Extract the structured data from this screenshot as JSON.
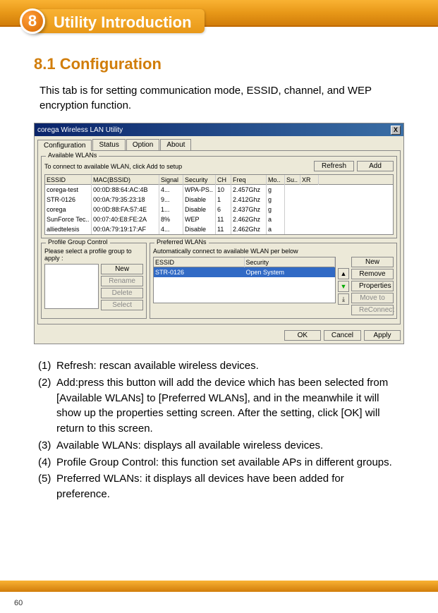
{
  "chapter": {
    "number": "8",
    "title": "Utility Introduction"
  },
  "section": {
    "heading": "8.1 Configuration"
  },
  "intro": "This tab is for setting communication mode, ESSID, channel, and WEP encryption function.",
  "dialog": {
    "title": "corega Wireless LAN Utility",
    "tabs": [
      "Configuration",
      "Status",
      "Option",
      "About"
    ],
    "available_group": "Available WLANs",
    "available_note": "To connect to available WLAN, click Add to setup",
    "btn_refresh": "Refresh",
    "btn_add": "Add",
    "columns": [
      "ESSID",
      "MAC(BSSID)",
      "Signal",
      "Security",
      "CH",
      "Freq",
      "Mo..",
      "Su..",
      "XR"
    ],
    "rows": [
      {
        "essid": "corega-test",
        "mac": "00:0D:88:64:AC:4B",
        "signal": "4...",
        "security": "WPA-PS..",
        "ch": "10",
        "freq": "2.457Ghz",
        "mo": "g",
        "su": "",
        "xr": ""
      },
      {
        "essid": "STR-0126",
        "mac": "00:0A:79:35:23:18",
        "signal": "9...",
        "security": "Disable",
        "ch": "1",
        "freq": "2.412Ghz",
        "mo": "g",
        "su": "",
        "xr": ""
      },
      {
        "essid": "corega",
        "mac": "00:0D:88:FA:57:4E",
        "signal": "1...",
        "security": "Disable",
        "ch": "6",
        "freq": "2.437Ghz",
        "mo": "g",
        "su": "",
        "xr": ""
      },
      {
        "essid": "SunForce Tec..",
        "mac": "00:07:40:E8:FE:2A",
        "signal": "8%",
        "security": "WEP",
        "ch": "11",
        "freq": "2.462Ghz",
        "mo": "a",
        "su": "",
        "xr": ""
      },
      {
        "essid": "alliedtelesis",
        "mac": "00:0A:79:19:17:AF",
        "signal": "4...",
        "security": "Disable",
        "ch": "11",
        "freq": "2.462Ghz",
        "mo": "a",
        "su": "",
        "xr": ""
      }
    ],
    "pgc_group": "Profile Group Control",
    "pgc_note": "Please select a profile group to apply :",
    "pgc_new": "New",
    "pgc_rename": "Rename",
    "pgc_delete": "Delete",
    "pgc_select": "Select",
    "pw_group": "Preferred WLANs",
    "pw_note": "Automatically connect to available WLAN per below",
    "pw_columns": [
      "ESSID",
      "Security"
    ],
    "pw_row": {
      "essid": "STR-0126",
      "security": "Open System"
    },
    "side_new": "New",
    "side_remove": "Remove",
    "side_properties": "Properties",
    "side_move": "Move to",
    "side_reconnect": "ReConnect",
    "btn_ok": "OK",
    "btn_cancel": "Cancel",
    "btn_apply": "Apply"
  },
  "notes": [
    {
      "n": "(1)",
      "t": "Refresh: rescan available wireless devices."
    },
    {
      "n": "(2)",
      "t": "Add:press this button will add the device which has been selected from [Available WLANs] to [Preferred WLANs], and in the meanwhile it will show up the properties setting screen. After the setting, click [OK] will return to this screen."
    },
    {
      "n": "(3)",
      "t": "Available WLANs: displays all available wireless devices."
    },
    {
      "n": "(4)",
      "t": "Profile Group Control: this function set available APs in different groups."
    },
    {
      "n": "(5)",
      "t": "Preferred WLANs: it displays all devices have been added for preference."
    }
  ],
  "page": "60"
}
